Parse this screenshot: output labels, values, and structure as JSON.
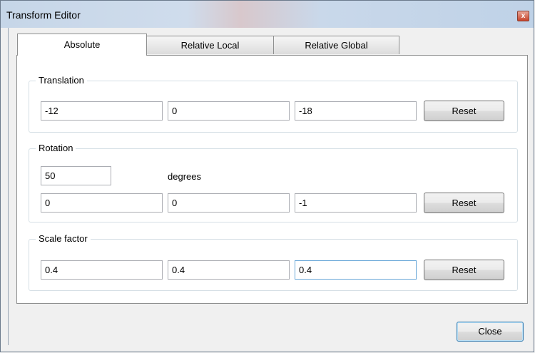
{
  "window": {
    "title": "Transform Editor",
    "close_glyph": "x"
  },
  "tabs": [
    {
      "label": "Absolute",
      "active": true
    },
    {
      "label": "Relative Local",
      "active": false
    },
    {
      "label": "Relative Global",
      "active": false
    }
  ],
  "translation": {
    "label": "Translation",
    "x": "-12",
    "y": "0",
    "z": "-18",
    "reset_label": "Reset"
  },
  "rotation": {
    "label": "Rotation",
    "angle": "50",
    "angle_unit": "degrees",
    "x": "0",
    "y": "0",
    "z": "-1",
    "reset_label": "Reset"
  },
  "scale": {
    "label": "Scale factor",
    "x": "0.4",
    "y": "0.4",
    "z": "0.4",
    "reset_label": "Reset"
  },
  "footer": {
    "close_label": "Close"
  }
}
